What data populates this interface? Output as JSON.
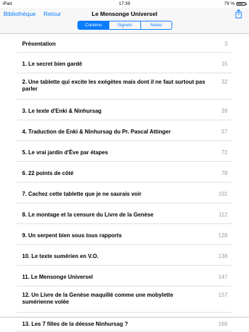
{
  "status_bar": {
    "device": "iPad",
    "time": "17:39",
    "battery": "79 %",
    "battery_level": 0.79
  },
  "nav": {
    "back_library": "Bibliothèque",
    "back": "Retour",
    "title": "Le Mensonge Universel",
    "share_icon": "share-icon"
  },
  "segments": [
    {
      "label": "Contenu",
      "active": true
    },
    {
      "label": "Signets",
      "active": false
    },
    {
      "label": "Notes",
      "active": false
    }
  ],
  "toc": [
    {
      "title": "Présentation",
      "page": "3"
    },
    {
      "title": "1. Le secret bien gardé",
      "page": "15"
    },
    {
      "title": "2. Une tablette qui excite les exégètes mais dont il ne faut surtout pas parler",
      "page": "32"
    },
    {
      "title": "3. Le texte d'Enki & Ninhursag",
      "page": "39"
    },
    {
      "title": "4. Traduction de Enki & Ninhursag du Pr. Pascal Attinger",
      "page": "57"
    },
    {
      "title": "5. Le vrai jardin d'Ève par étapes",
      "page": "72"
    },
    {
      "title": "6. 22 points de côté",
      "page": "78"
    },
    {
      "title": "7. Cachez cette tablette que je ne saurais voir",
      "page": "101"
    },
    {
      "title": "8. Le montage et la censure du Livre de la Genèse",
      "page": "112"
    },
    {
      "title": "9. Un serpent bien sous tous rapports",
      "page": "128"
    },
    {
      "title": "10. Le texte sumérien en V.O.",
      "page": "138"
    },
    {
      "title": "11. Le Mensonge Universel",
      "page": "147"
    },
    {
      "title": "12. Un Livre de la Genèse maquillé comme une mobylette sumérienne volée",
      "page": "157"
    },
    {
      "title": "13. Les 7 filles de la déesse Ninhursag ?",
      "page": "166"
    }
  ]
}
